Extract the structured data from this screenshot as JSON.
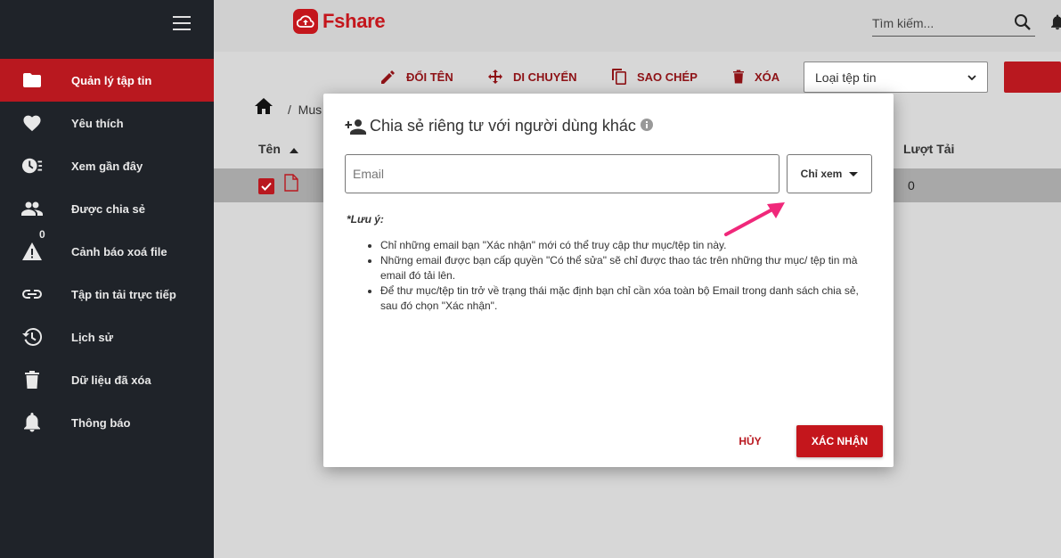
{
  "sidebar": {
    "items": [
      {
        "label": "Quản lý tập tin",
        "icon": "folder-icon",
        "active": true
      },
      {
        "label": "Yêu thích",
        "icon": "heart-icon"
      },
      {
        "label": "Xem gần đây",
        "icon": "recent-clock-icon"
      },
      {
        "label": "Được chia sẻ",
        "icon": "people-icon"
      },
      {
        "label": "Cảnh báo xoá file",
        "icon": "warning-icon",
        "badge": "0"
      },
      {
        "label": "Tập tin tải trực tiếp",
        "icon": "link-icon"
      },
      {
        "label": "Lịch sử",
        "icon": "history-icon"
      },
      {
        "label": "Dữ liệu đã xóa",
        "icon": "trash-icon"
      },
      {
        "label": "Thông báo",
        "icon": "bell-icon"
      }
    ]
  },
  "header": {
    "brand": "Fshare",
    "search_placeholder": "Tìm kiếm..."
  },
  "toolbar": {
    "rename": "ĐỔI TÊN",
    "move": "DI CHUYỂN",
    "copy": "SAO CHÉP",
    "delete": "XÓA",
    "file_type": "Loại tệp tin"
  },
  "content": {
    "breadcrumb": "Mus",
    "col_name": "Tên",
    "col_downloads": "Lượt Tải",
    "rows": [
      {
        "downloads": "0"
      }
    ]
  },
  "modal": {
    "title": "Chia sẻ riêng tư với người dùng khác",
    "email_placeholder": "Email",
    "permission": "Chỉ xem",
    "note_title": "*Lưu ý:",
    "notes": [
      "Chỉ những email bạn \"Xác nhận\" mới có thể truy cập thư mục/tệp tin này.",
      "Những email được bạn cấp quyền \"Có thể sửa\" sẽ chỉ được thao tác trên những thư mục/ tệp tin mà email đó tải lên.",
      "Để thư mục/tệp tin trở về trạng thái mặc định bạn chỉ cần xóa toàn bộ Email trong danh sách chia sẻ, sau đó chọn \"Xác nhận\"."
    ],
    "cancel": "HỦY",
    "confirm": "XÁC NHẬN"
  },
  "colors": {
    "brand_red": "#c4161c",
    "sidebar_bg": "#1f2329",
    "arrow_pink": "#f0287a"
  }
}
